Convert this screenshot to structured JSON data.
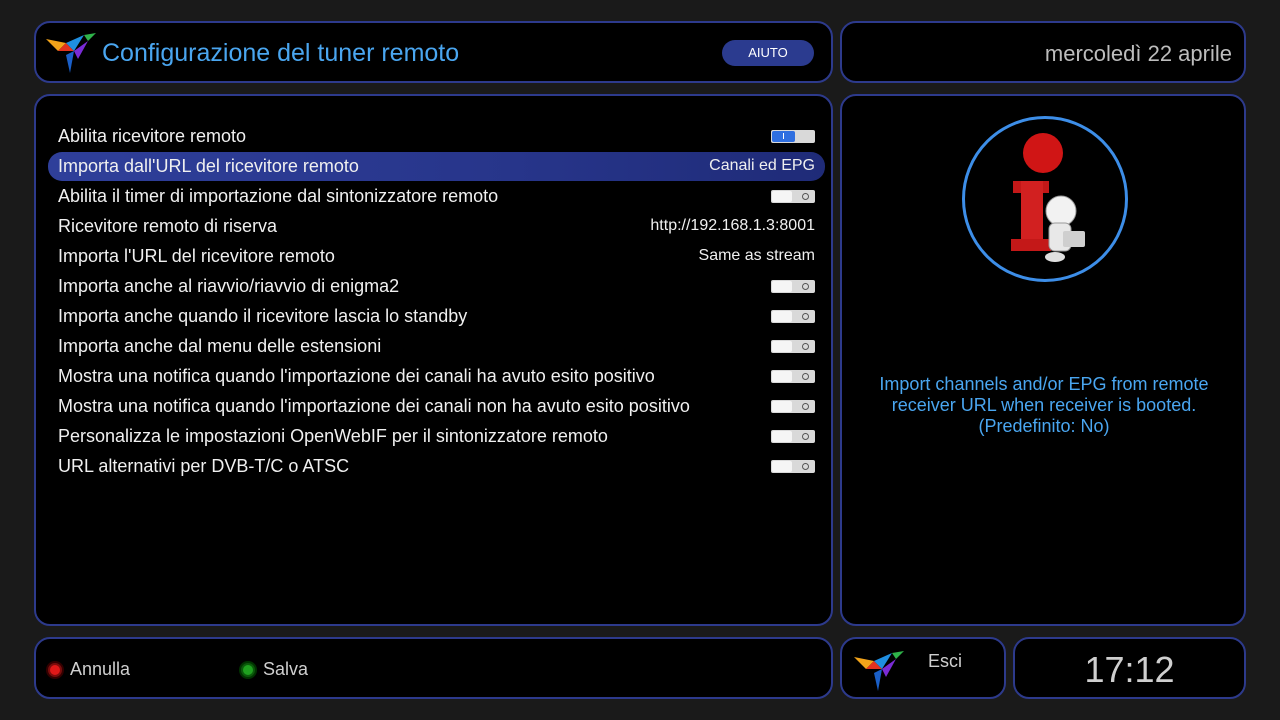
{
  "header": {
    "title": "Configurazione del tuner remoto",
    "help_label": "AIUTO",
    "date": "mercoledì 22 aprile"
  },
  "settings": [
    {
      "label": "Abilita ricevitore remoto",
      "type": "toggle",
      "on": true,
      "selected": false
    },
    {
      "label": "Importa dall'URL del ricevitore remoto",
      "type": "value",
      "value": "Canali ed EPG",
      "selected": true
    },
    {
      "label": "Abilita il timer di importazione dal sintonizzatore remoto",
      "type": "toggle",
      "on": false,
      "selected": false
    },
    {
      "label": "Ricevitore remoto di riserva",
      "type": "value",
      "value": "http://192.168.1.3:8001",
      "selected": false
    },
    {
      "label": "Importa l'URL del ricevitore remoto",
      "type": "value",
      "value": "Same as stream",
      "selected": false
    },
    {
      "label": "Importa anche al riavvio/riavvio di enigma2",
      "type": "toggle",
      "on": false,
      "selected": false
    },
    {
      "label": "Importa anche quando il ricevitore lascia lo standby",
      "type": "toggle",
      "on": false,
      "selected": false
    },
    {
      "label": "Importa anche dal menu delle estensioni",
      "type": "toggle",
      "on": false,
      "selected": false
    },
    {
      "label": "Mostra una notifica quando l'importazione dei canali ha avuto esito positivo",
      "type": "toggle",
      "on": false,
      "selected": false
    },
    {
      "label": "Mostra una notifica quando l'importazione dei canali non ha avuto esito positivo",
      "type": "toggle",
      "on": false,
      "selected": false
    },
    {
      "label": "Personalizza le impostazioni OpenWebIF per il sintonizzatore remoto",
      "type": "toggle",
      "on": false,
      "selected": false
    },
    {
      "label": "URL alternativi per DVB-T/C o ATSC",
      "type": "toggle",
      "on": false,
      "selected": false
    }
  ],
  "info": {
    "icon": "info-person-icon",
    "description_line1": "Import channels and/or EPG from remote",
    "description_line2": "receiver URL when receiver is booted.",
    "description_line3": "(Predefinito: No)"
  },
  "footer": {
    "red_label": "Annulla",
    "green_label": "Salva",
    "exit_label": "Esci",
    "clock": "17:12"
  },
  "colors": {
    "accent": "#4aa6f0",
    "border": "#2d3a8c",
    "selection": "#2f3f9a",
    "red_key": "#e01818",
    "green_key": "#1fa01f"
  }
}
